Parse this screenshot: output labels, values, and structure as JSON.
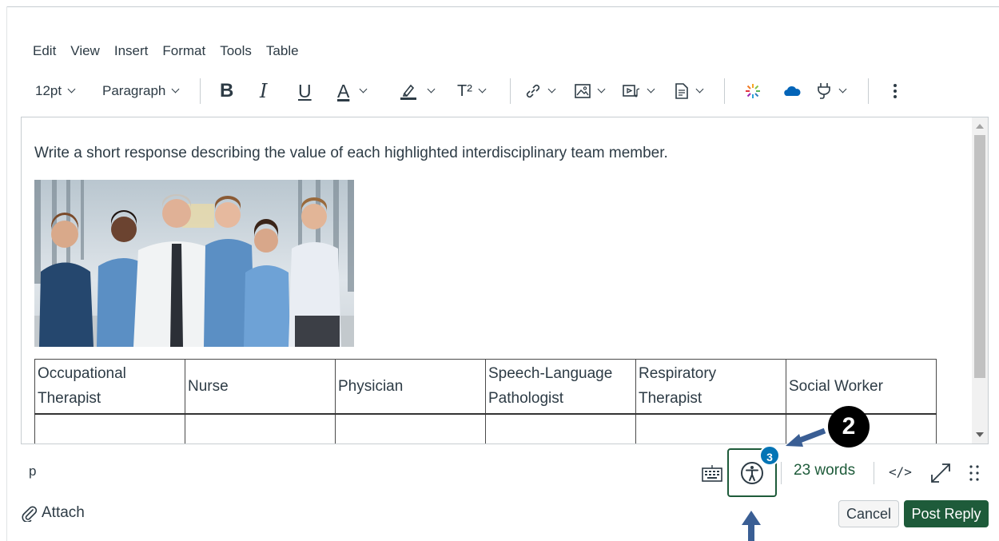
{
  "menubar": {
    "items": [
      "Edit",
      "View",
      "Insert",
      "Format",
      "Tools",
      "Table"
    ]
  },
  "toolbar": {
    "font_size": "12pt",
    "block_format": "Paragraph",
    "bold_glyph": "B",
    "italic_glyph": "I",
    "underline_glyph": "U",
    "text_color_glyph": "A",
    "superscript_glyph": "T²",
    "icons": [
      "bold-icon",
      "italic-icon",
      "underline-icon",
      "text-color-icon",
      "highlight-icon",
      "superscript-icon",
      "link-icon",
      "image-icon",
      "media-icon",
      "document-icon",
      "apps-icon",
      "onedrive-icon",
      "plugin-icon",
      "more-icon"
    ]
  },
  "editor": {
    "prompt": "Write a short response describing the value of each highlighted interdisciplinary team member.",
    "table": {
      "headers": [
        "Occupational Therapist",
        "Nurse",
        "Physician",
        "Speech-Language Pathologist",
        "Respiratory Therapist",
        "Social Worker"
      ],
      "rows": [
        [
          "",
          "",
          "",
          "",
          "",
          ""
        ]
      ]
    }
  },
  "statusbar": {
    "path": "p",
    "a11y_badge": "3",
    "word_count": "23 words",
    "html_toggle": "</>"
  },
  "annotation": {
    "step": "2"
  },
  "actions": {
    "attach": "Attach",
    "cancel": "Cancel",
    "post": "Post Reply"
  },
  "colors": {
    "primary": "#1e5b3a",
    "badge": "#0374b5",
    "annotation_arrow": "#3a5e94"
  }
}
